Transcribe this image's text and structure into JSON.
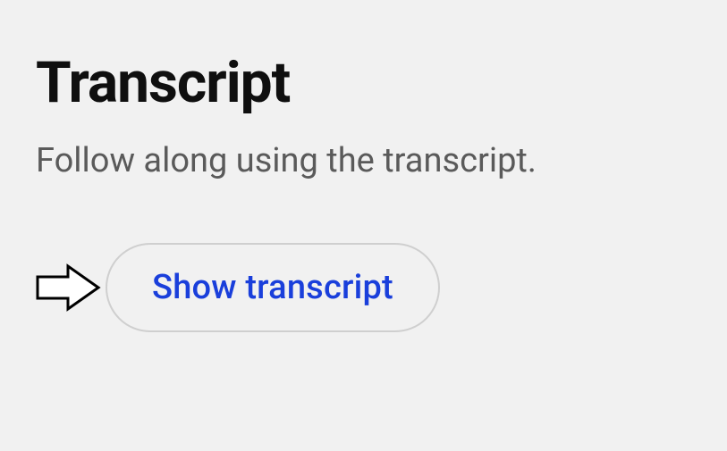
{
  "transcript": {
    "heading": "Transcript",
    "description": "Follow along using the transcript.",
    "button_label": "Show transcript"
  }
}
